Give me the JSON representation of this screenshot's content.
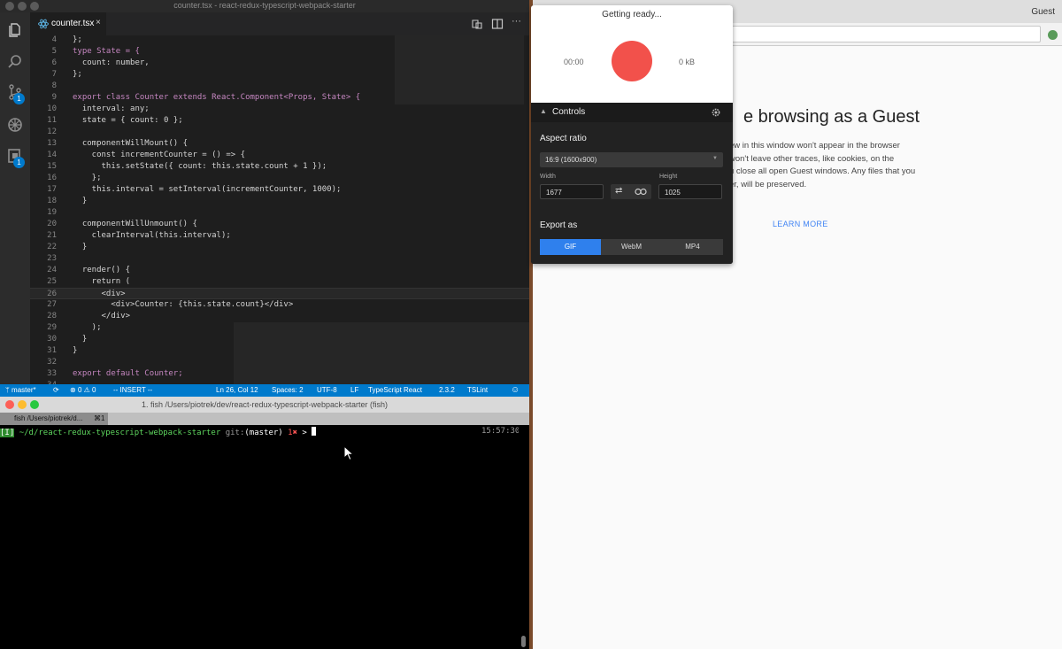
{
  "vscode": {
    "window_title": "counter.tsx - react-redux-typescript-webpack-starter",
    "tab_label": "counter.tsx",
    "badges": {
      "scm": "1",
      "extensions": "1"
    },
    "lines": [
      {
        "n": "4",
        "text": "};"
      },
      {
        "n": "5",
        "text": "type State = {"
      },
      {
        "n": "6",
        "text": "  count: number,"
      },
      {
        "n": "7",
        "text": "};"
      },
      {
        "n": "8",
        "text": ""
      },
      {
        "n": "9",
        "text": "export class Counter extends React.Component<Props, State> {"
      },
      {
        "n": "10",
        "text": "  interval: any;"
      },
      {
        "n": "11",
        "text": "  state = { count: 0 };"
      },
      {
        "n": "12",
        "text": ""
      },
      {
        "n": "13",
        "text": "  componentWillMount() {"
      },
      {
        "n": "14",
        "text": "    const incrementCounter = () => {"
      },
      {
        "n": "15",
        "text": "      this.setState({ count: this.state.count + 1 });"
      },
      {
        "n": "16",
        "text": "    };"
      },
      {
        "n": "17",
        "text": "    this.interval = setInterval(incrementCounter, 1000);"
      },
      {
        "n": "18",
        "text": "  }"
      },
      {
        "n": "19",
        "text": ""
      },
      {
        "n": "20",
        "text": "  componentWillUnmount() {"
      },
      {
        "n": "21",
        "text": "    clearInterval(this.interval);"
      },
      {
        "n": "22",
        "text": "  }"
      },
      {
        "n": "23",
        "text": ""
      },
      {
        "n": "24",
        "text": "  render() {"
      },
      {
        "n": "25",
        "text": "    return ("
      },
      {
        "n": "26",
        "text": "      <div>"
      },
      {
        "n": "27",
        "text": "        <div>Counter: {this.state.count}</div>"
      },
      {
        "n": "28",
        "text": "      </div>"
      },
      {
        "n": "29",
        "text": "    );"
      },
      {
        "n": "30",
        "text": "  }"
      },
      {
        "n": "31",
        "text": "}"
      },
      {
        "n": "32",
        "text": ""
      },
      {
        "n": "33",
        "text": "export default Counter;"
      },
      {
        "n": "34",
        "text": ""
      }
    ],
    "current_line": "26",
    "status": {
      "branch": "master*",
      "errors": "0",
      "warnings": "0",
      "mode": "-- INSERT --",
      "position": "Ln 26, Col 12",
      "spaces": "Spaces: 2",
      "encoding": "UTF-8",
      "eol": "LF",
      "language": "TypeScript React",
      "ts_version": "2.3.2",
      "linter": "TSLint"
    }
  },
  "terminal": {
    "window_title": "1. fish  /Users/piotrek/dev/react-redux-typescript-webpack-starter (fish)",
    "tab_label": "fish  /Users/piotrek/d...",
    "tab_shortcut": "⌘1",
    "prompt_mode": "[I]",
    "prompt_path": "~/d/react-redux-typescript-webpack-starter",
    "prompt_git": "git:",
    "prompt_branch": "(master)",
    "prompt_dirty": "1✖",
    "prompt_arrow": ">",
    "clock": "15:57:30"
  },
  "browser": {
    "profile": "Guest",
    "heading": "e browsing as a Guest",
    "body": "ew in this window won't appear in the browser\nwon't leave other traces, like cookies, on the\nu close all open Guest windows. Any files that you\ner, will be preserved.",
    "learn_more": "LEARN MORE"
  },
  "recorder": {
    "status": "Getting ready...",
    "elapsed": "00:00",
    "size": "0 kB",
    "controls_label": "Controls",
    "aspect_ratio_label": "Aspect ratio",
    "aspect_ratio_value": "16:9 (1600x900)",
    "width_label": "Width",
    "width_value": "1677",
    "height_label": "Height",
    "height_value": "1025",
    "export_label": "Export as",
    "formats": [
      "GIF",
      "WebM",
      "MP4"
    ],
    "selected_format": "GIF",
    "colors": {
      "record": "#f2514b",
      "selected": "#2f80ed"
    }
  },
  "colors": {
    "status_bar": "#007acc",
    "editor_bg": "#1e1e1e",
    "keyword": "#c586c0",
    "ts_keyword": "#ff5c5c"
  }
}
